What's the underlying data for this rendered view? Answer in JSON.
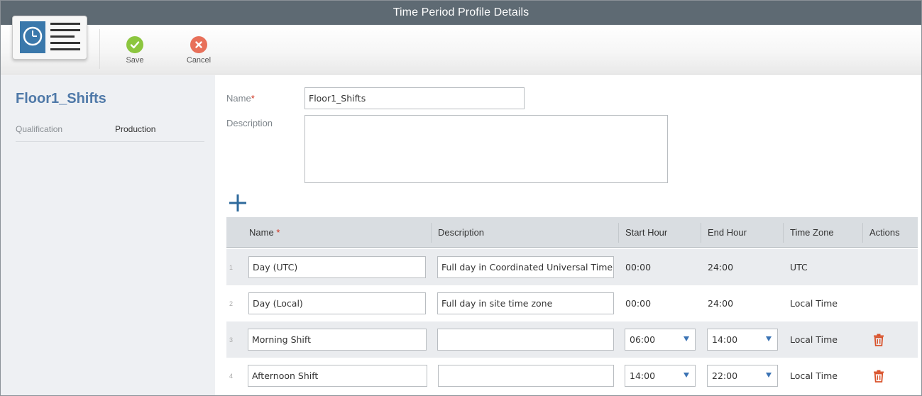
{
  "window": {
    "title": "Time Period Profile Details"
  },
  "toolbar": {
    "save_label": "Save",
    "cancel_label": "Cancel",
    "colors": {
      "save": "#8cc63f",
      "cancel": "#e8705a"
    }
  },
  "left_panel": {
    "title": "Floor1_Shifts",
    "qualification_label": "Qualification",
    "qualification_value": "Production"
  },
  "form": {
    "name_label": "Name",
    "name_required_mark": "*",
    "name_value": "Floor1_Shifts",
    "description_label": "Description",
    "description_value": ""
  },
  "grid": {
    "add_icon": "plus-icon",
    "columns": {
      "name": "Name",
      "name_required_mark": "*",
      "description": "Description",
      "start_hour": "Start Hour",
      "end_hour": "End Hour",
      "time_zone": "Time Zone",
      "actions": "Actions"
    },
    "rows": [
      {
        "num": "1",
        "name": "Day (UTC)",
        "description": "Full day in Coordinated Universal Time",
        "start": "00:00",
        "end": "24:00",
        "tz": "UTC"
      },
      {
        "num": "2",
        "name": "Day (Local)",
        "description": "Full day in site time zone",
        "start": "00:00",
        "end": "24:00",
        "tz": "Local Time"
      },
      {
        "num": "3",
        "name": "Morning Shift",
        "description": "",
        "start": "06:00",
        "end": "14:00",
        "tz": "Local Time"
      },
      {
        "num": "4",
        "name": "Afternoon Shift",
        "description": "",
        "start": "14:00",
        "end": "22:00",
        "tz": "Local Time"
      }
    ]
  },
  "colors": {
    "title_bar": "#5e6a73",
    "accent_blue": "#4f79a8",
    "add_icon": "#2e6a9c",
    "delete_icon": "#d9532c",
    "required": "#d0321e"
  }
}
